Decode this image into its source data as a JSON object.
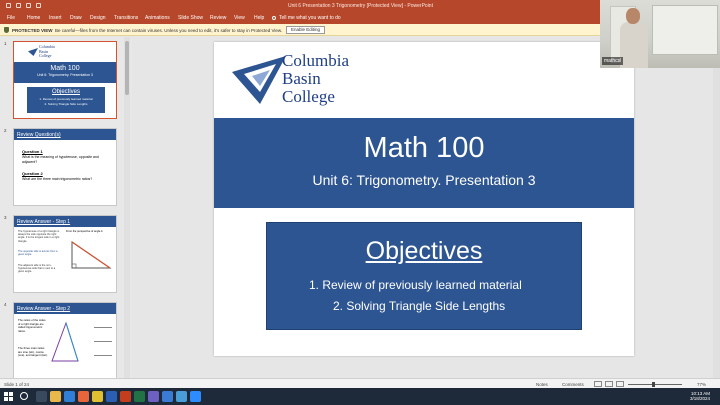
{
  "titlebar": {
    "document_title": "Unit 6 Presentation 3 Trigonometry [Protected View] - PowerPoint"
  },
  "ribbon": {
    "tabs": [
      "File",
      "Home",
      "Insert",
      "Draw",
      "Design",
      "Transitions",
      "Animations",
      "Slide Show",
      "Review",
      "View",
      "Help"
    ],
    "tell_me": "Tell me what you want to do"
  },
  "protected_view": {
    "label": "PROTECTED VIEW",
    "message": "Be careful—files from the Internet can contain viruses. Unless you need to edit, it's safer to stay in Protected View.",
    "button": "Enable Editing"
  },
  "webcam": {
    "name": "mathcsl"
  },
  "thumbnails": [
    {
      "number": "1",
      "title": "Math 100",
      "subtitle": "Unit 6: Trigonometry. Presentation 3",
      "heading": "Objectives",
      "lines": [
        "1. Review of previously learned material",
        "2. Solving Triangle Side Lengths"
      ]
    },
    {
      "number": "2",
      "title": "Review Question(s)",
      "q1_label": "Question 1",
      "q1_text": "What is the meaning of hypotenuse, opposite and adjacent?",
      "q2_label": "Question 2",
      "q2_text": "What are the three main trigonometric ratios?"
    },
    {
      "number": "3",
      "title": "Review Answer - Step 1",
      "left_text": "The hypotenuse of a right triangle is always the side opposite the right angle. It is the longest side in a right triangle.",
      "mid_text": "The opposite side is across from a given angle.",
      "bottom_text": "The adjacent side is the non-hypotenuse side that is next to a given angle.",
      "right_text": "From the perspective of angle A"
    },
    {
      "number": "4",
      "title": "Review Answer - Step 2",
      "left_text": "The ratios of the sides of a right triangle are called trigonometric ratios.",
      "bottom_text": "The three main ratios are sine (sin), cosine (cos), and tangent (tan)."
    }
  ],
  "slide": {
    "logo_lines": [
      "Columbia",
      "Basin",
      "College"
    ],
    "title": "Math 100",
    "subtitle": "Unit 6: Trigonometry. Presentation 3",
    "objectives_heading": "Objectives",
    "objectives": [
      "1.   Review of previously learned material",
      "2.   Solving Triangle Side Lengths"
    ]
  },
  "statusbar": {
    "slide_count": "Slide 1 of 24",
    "notes": "Notes",
    "comments": "Comments",
    "zoom": "77%"
  },
  "taskbar": {
    "time": "10:13 AM",
    "date": "3/18/2024"
  },
  "colors": {
    "accent": "#b7472a",
    "slide_blue": "#2d5592",
    "logo_blue": "#1f3f86"
  }
}
